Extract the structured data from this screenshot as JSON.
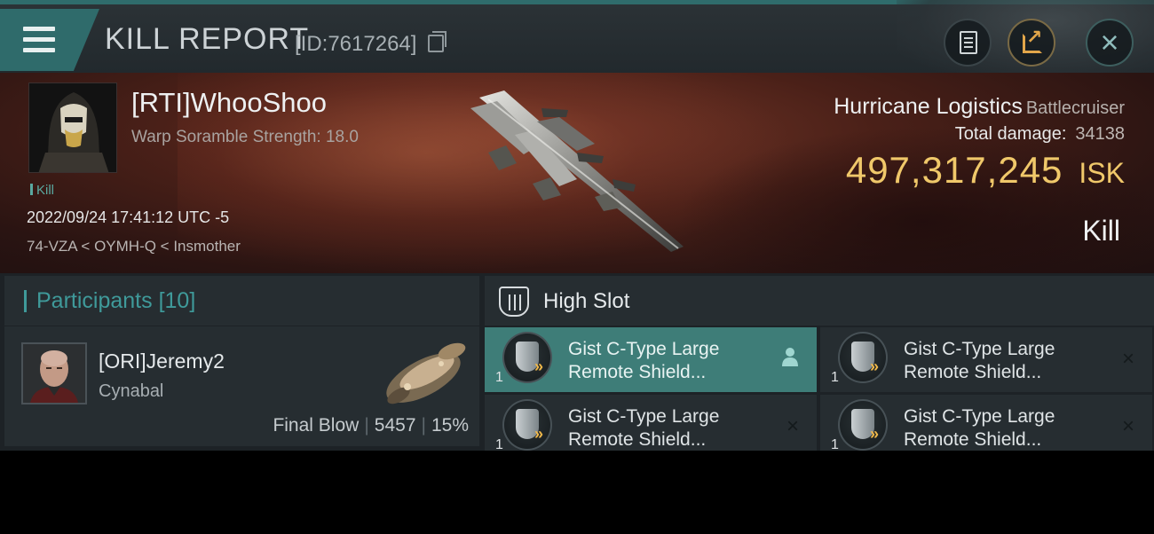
{
  "header": {
    "title": "KILL REPORT",
    "report_id": "[ID:7617264]"
  },
  "victim": {
    "name": "[RTI]WhooShoo",
    "warp_scramble": "Warp Soramble Strength: 18.0",
    "tag": "Kill",
    "datetime": "2022/09/24 17:41:12 UTC -5",
    "location": "74-VZA < OYMH-Q < Insmother"
  },
  "ship": {
    "name": "Hurricane Logistics",
    "class": "Battlecruiser",
    "total_damage_label": "Total damage:",
    "total_damage": "34138",
    "isk_value": "497,317,245",
    "isk_unit": "ISK",
    "result": "Kill"
  },
  "participants": {
    "label": "Participants",
    "count": "[10]",
    "items": [
      {
        "name": "[ORI]Jeremy2",
        "ship": "Cynabal",
        "role": "Final Blow",
        "damage": "5457",
        "percent": "15%"
      }
    ]
  },
  "high_slot": {
    "title": "High Slot",
    "modules": [
      {
        "qty": "1",
        "line1": "Gist C-Type Large",
        "line2": "Remote Shield...",
        "action": "person"
      },
      {
        "qty": "1",
        "line1": "Gist C-Type Large",
        "line2": "Remote Shield...",
        "action": "×"
      },
      {
        "qty": "1",
        "line1": "Gist C-Type Large",
        "line2": "Remote Shield...",
        "action": "×"
      },
      {
        "qty": "1",
        "line1": "Gist C-Type Large",
        "line2": "Remote Shield...",
        "action": "×"
      }
    ]
  },
  "colors": {
    "accent_teal": "#3f9a9a",
    "isk_gold": "#f0c86a",
    "selected_slot": "#3e7d78"
  }
}
